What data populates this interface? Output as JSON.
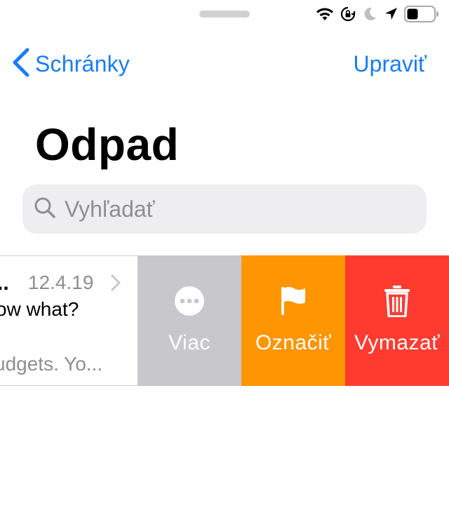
{
  "status_bar": {
    "icons": [
      "wifi-icon",
      "orientation-lock-icon",
      "moon-icon",
      "location-arrow-icon",
      "battery-icon"
    ]
  },
  "nav": {
    "back_label": "Schránky",
    "edit_label": "Upraviť"
  },
  "page_title": "Odpad",
  "search": {
    "placeholder": "Vyhľadať"
  },
  "mail_row": {
    "sender": "..",
    "date": "12.4.19",
    "subject": "ow what?",
    "preview": "udgets. Yo..."
  },
  "swipe_actions": {
    "more": {
      "label": "Viac",
      "icon": "ellipsis-circle-icon",
      "color": "#c7c7cc"
    },
    "flag": {
      "label": "Označiť",
      "icon": "flag-icon",
      "color": "#ff9500"
    },
    "delete": {
      "label": "Vymazať",
      "icon": "trash-icon",
      "color": "#ff3b30"
    }
  },
  "colors": {
    "accent": "#1a7cf5"
  }
}
